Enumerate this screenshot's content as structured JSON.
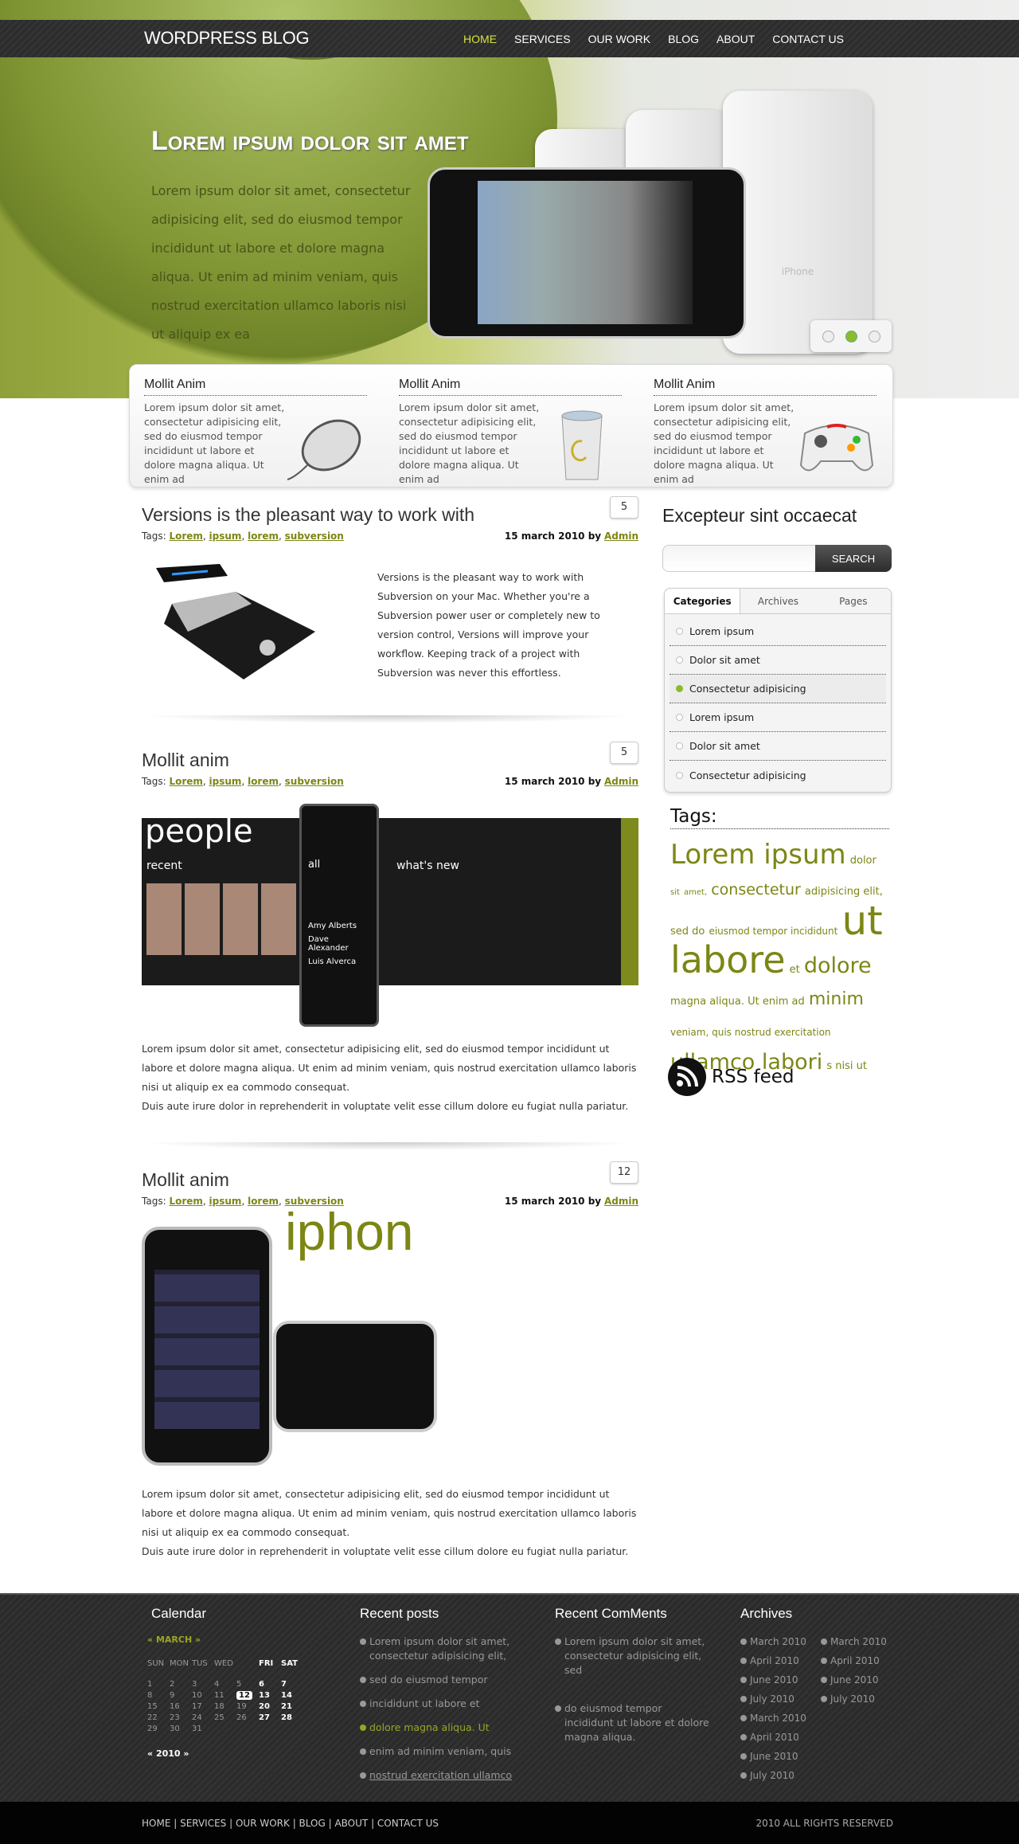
{
  "header": {
    "logo": "WORDPRESS BLOG",
    "menu": [
      "HOME",
      "SERVICES",
      "OUR WORK",
      "BLOG",
      "ABOUT",
      "CONTACT US"
    ],
    "active": "HOME"
  },
  "hero": {
    "title": "Lorem ipsum dolor sit amet",
    "text": "Lorem ipsum dolor sit amet, consectetur adipisicing elit, sed do eiusmod tempor incididunt ut labore et dolore magna aliqua. Ut enim ad minim veniam, quis nostrud exercitation ullamco laboris nisi ut aliquip ex ea",
    "slides": 3,
    "active_slide": 2,
    "phone_label": "iPhone"
  },
  "features": [
    {
      "title": "Mollit Anim",
      "text": "Lorem ipsum dolor sit amet, consectetur adipisicing elit, sed do eiusmod tempor incididunt ut labore et dolore magna aliqua. Ut enim ad",
      "icon": "mouse-icon"
    },
    {
      "title": "Mollit Anim",
      "text": "Lorem ipsum dolor sit amet, consectetur adipisicing elit, sed do eiusmod tempor incididunt ut labore et dolore magna aliqua. Ut enim ad",
      "icon": "trash-icon"
    },
    {
      "title": "Mollit Anim",
      "text": "Lorem ipsum dolor sit amet, consectetur adipisicing elit, sed do eiusmod tempor incididunt ut labore et dolore magna aliqua. Ut enim ad",
      "icon": "gamepad-icon"
    }
  ],
  "posts": [
    {
      "title": "Versions is the pleasant way to work with",
      "comments": "5",
      "tags_label": "Tags:",
      "tags": [
        "Lorem",
        "ipsum",
        "lorem",
        "subversion"
      ],
      "date": "15 march 2010 by",
      "author": "Admin",
      "text": "Versions is the pleasant way to work with Subversion on your Mac. Whether you're a Subversion power user or completely new to version control, Versions will improve your workflow. Keeping track of a project with Subversion was never this effortless."
    },
    {
      "title": "Mollit anim",
      "comments": "5",
      "tags_label": "Tags:",
      "tags": [
        "Lorem",
        "ipsum",
        "lorem",
        "subversion"
      ],
      "date": "15 march 2010 by",
      "author": "Admin",
      "text": "Lorem ipsum dolor sit amet, consectetur adipisicing elit, sed do eiusmod tempor incididunt ut labore et dolore magna aliqua. Ut enim ad minim veniam, quis nostrud exercitation ullamco laboris nisi ut aliquip ex ea commodo consequat.",
      "text2": "Duis aute irure dolor in reprehenderit in voluptate velit esse cillum dolore eu fugiat nulla pariatur.",
      "image_text": {
        "people": "people",
        "recent": "recent",
        "all": "all",
        "whats_new": "what's new",
        "names": [
          "Amy Alberts",
          "Dave Alexander",
          "Luis Alverca"
        ]
      }
    },
    {
      "title": "Mollit anim",
      "comments": "12",
      "tags_label": "Tags:",
      "tags": [
        "Lorem",
        "ipsum",
        "lorem",
        "subversion"
      ],
      "date": "15 march 2010 by",
      "author": "Admin",
      "text": "Lorem ipsum dolor sit amet, consectetur adipisicing elit, sed do eiusmod tempor incididunt ut labore et dolore magna aliqua. Ut enim ad minim veniam, quis nostrud exercitation ullamco laboris nisi ut aliquip ex ea commodo consequat.",
      "text2": "Duis aute irure dolor in reprehenderit in voluptate velit esse cillum dolore eu fugiat nulla pariatur.",
      "image_text": "iphon"
    }
  ],
  "sidebar": {
    "heading": "Excepteur sint occaecat",
    "search": {
      "value": "",
      "button": "SEARCH"
    },
    "tabs": [
      "Categories",
      "Archives",
      "Pages"
    ],
    "active_tab": "Categories",
    "categories": [
      "Lorem ipsum",
      "Dolor sit amet",
      "Consectetur adipisicing",
      "Lorem ipsum",
      "Dolor sit amet",
      "Consectetur adipisicing"
    ],
    "selected_category": 2,
    "tags_heading": "Tags:",
    "tag_cloud": [
      [
        "Lorem ipsum",
        34
      ],
      [
        "dolor",
        13
      ],
      [
        "sit",
        10
      ],
      [
        "amet,",
        10
      ],
      [
        "consectetur",
        19
      ],
      [
        "adipisicing elit, sed do",
        13
      ],
      [
        "eiusmod tempor incididunt",
        12
      ],
      [
        "ut",
        50
      ],
      [
        "labore",
        46
      ],
      [
        "et",
        13
      ],
      [
        "dolore",
        27
      ],
      [
        "magna aliqua. Ut enim ad",
        13
      ],
      [
        "minim",
        22
      ],
      [
        "veniam, quis nostrud exercitation",
        12
      ],
      [
        "ullamco labori",
        27
      ],
      [
        "s nisi ut",
        13
      ]
    ],
    "rss": "RSS feed",
    "accent": "#7c8614"
  },
  "footer": {
    "calendar": {
      "heading": "Calendar",
      "month": "MARCH",
      "year": "2010",
      "days": [
        "SUN",
        "MON",
        "TUS",
        "WED",
        "FRI",
        "SAT"
      ],
      "weeks": [
        [
          "1",
          "2",
          "3",
          "4",
          "5",
          "6",
          "7"
        ],
        [
          "8",
          "9",
          "10",
          "11",
          "12",
          "13",
          "14"
        ],
        [
          "15",
          "16",
          "17",
          "18",
          "19",
          "20",
          "21"
        ],
        [
          "22",
          "23",
          "24",
          "25",
          "26",
          "27",
          "28"
        ],
        [
          "29",
          "30",
          "31"
        ]
      ],
      "today": "12"
    },
    "recent_posts": {
      "heading": "Recent posts",
      "items": [
        "Lorem ipsum dolor sit amet, consectetur adipisicing elit,",
        "sed do eiusmod tempor",
        "incididunt ut labore et",
        "dolore magna aliqua. Ut",
        "enim ad minim veniam, quis",
        "nostrud exercitation ullamco"
      ],
      "highlighted": 3
    },
    "recent_comments": {
      "heading": "Recent ComMents",
      "items": [
        "Lorem ipsum dolor sit amet, consectetur adipisicing elit, sed",
        "do eiusmod tempor incididunt ut labore et dolore magna aliqua."
      ]
    },
    "archives": {
      "heading": "Archives",
      "col1": [
        "March 2010",
        "April 2010",
        "June 2010",
        "July 2010",
        "March 2010",
        "April 2010",
        "June 2010",
        "July 2010"
      ],
      "col2": [
        "March 2010",
        "April 2010",
        "June 2010",
        "July 2010"
      ]
    },
    "links": [
      "HOME",
      "SERVICES",
      "OUR WORK",
      "BLOG",
      "ABOUT",
      "CONTACT US"
    ],
    "copyright": "2010 ALL RIGHTS RESERVED"
  }
}
